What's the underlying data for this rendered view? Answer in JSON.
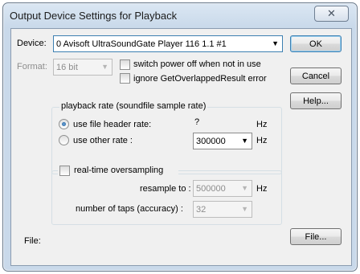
{
  "window": {
    "title": "Output Device Settings for Playback",
    "close_glyph": "✕"
  },
  "device": {
    "label": "Device:",
    "value": "0 Avisoft UltraSoundGate Player 116 1.1 #1"
  },
  "format": {
    "label": "Format:",
    "value": "16 bit"
  },
  "options": {
    "switch_power_label": "switch power off when not in use",
    "ignore_overlapped_label": "ignore GetOverlappedResult error"
  },
  "playback_rate": {
    "group_title": "playback rate (soundfile sample rate)",
    "use_header_label": "use file header rate:",
    "header_rate_value": "?",
    "header_rate_unit": "Hz",
    "use_other_label": "use other rate :",
    "other_rate_value": "300000",
    "other_rate_unit": "Hz",
    "selected": "use file header rate"
  },
  "oversampling": {
    "enable_label": "real-time oversampling",
    "resample_label": "resample to :",
    "resample_value": "500000",
    "resample_unit": "Hz",
    "taps_label": "number of taps (accuracy) :",
    "taps_value": "32"
  },
  "file": {
    "label": "File:"
  },
  "buttons": {
    "ok": "OK",
    "cancel": "Cancel",
    "help": "Help...",
    "file": "File..."
  }
}
